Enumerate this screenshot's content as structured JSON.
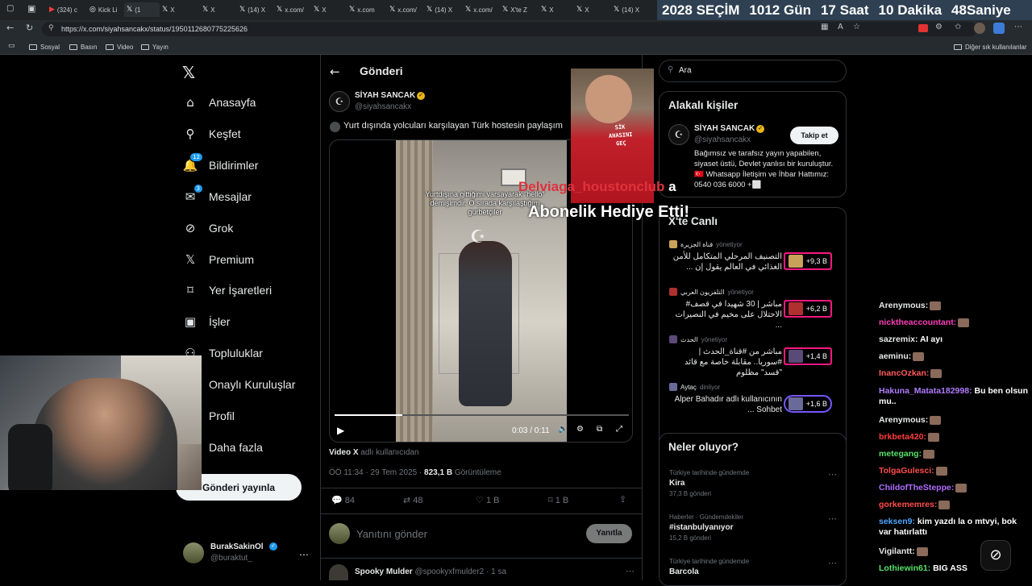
{
  "browser": {
    "tabs": [
      {
        "label": "(324) c",
        "icon": "youtube-icon"
      },
      {
        "label": "Kick Li",
        "icon": "globe-icon"
      },
      {
        "label": "(1",
        "icon": "x-icon"
      },
      {
        "label": "X",
        "icon": "x-icon"
      },
      {
        "label": "X",
        "icon": "x-icon"
      },
      {
        "label": "(14) X",
        "icon": "x-icon"
      },
      {
        "label": "x.com/",
        "icon": "x-icon"
      },
      {
        "label": "X",
        "icon": "x-icon"
      },
      {
        "label": "x.com",
        "icon": "x-icon"
      },
      {
        "label": "x.com/",
        "icon": "x-icon"
      },
      {
        "label": "(14) X",
        "icon": "x-icon"
      },
      {
        "label": "x.com/",
        "icon": "x-icon"
      },
      {
        "label": "X'te Z",
        "icon": "x-icon"
      },
      {
        "label": "X",
        "icon": "x-icon"
      },
      {
        "label": "X",
        "icon": "x-icon"
      },
      {
        "label": "(14) X",
        "icon": "x-icon"
      }
    ],
    "url": "https://x.com/siyahsancakx/status/1950112680775225626",
    "bookmarks": [
      "Sosyal",
      "Basın",
      "Video",
      "Yayın"
    ],
    "other_bookmarks": "Diğer sık kullanılanlar"
  },
  "countdown": {
    "year": "2028",
    "label": "SEÇİM",
    "days": "1012",
    "days_label": "Gün",
    "hours": "17",
    "hours_label": "Saat",
    "minutes": "10",
    "minutes_label": "Dakika",
    "seconds": "48",
    "seconds_label": "Saniye"
  },
  "nav": {
    "items": [
      {
        "label": "Anasayfa",
        "icon": "home-icon"
      },
      {
        "label": "Keşfet",
        "icon": "search-icon"
      },
      {
        "label": "Bildirimler",
        "icon": "bell-icon",
        "badge": "12"
      },
      {
        "label": "Mesajlar",
        "icon": "mail-icon",
        "badge": "3"
      },
      {
        "label": "Grok",
        "icon": "grok-icon"
      },
      {
        "label": "Premium",
        "icon": "x-logo-icon"
      },
      {
        "label": "Yer İşaretleri",
        "icon": "bookmark-icon"
      },
      {
        "label": "İşler",
        "icon": "briefcase-icon"
      },
      {
        "label": "Topluluklar",
        "icon": "people-icon"
      },
      {
        "label": "Onaylı Kuruluşlar",
        "icon": "verified-icon"
      },
      {
        "label": "Profil",
        "icon": "person-icon"
      },
      {
        "label": "Daha fazla",
        "icon": "more-icon"
      }
    ],
    "post_button": "Gönderi yayınla",
    "account": {
      "name": "BurakSakinOl",
      "handle": "@buraktut_"
    }
  },
  "post": {
    "header": "Gönderi",
    "author": "SİYAH SANCAK",
    "handle": "@siyahsancakx",
    "text": "Yurt dışında yolcuları karşılayan Türk hostesin paylaşım",
    "video_caption": "Yurtdışına gittiğimi varsayarak \"hello\" demişimdir. O sırada karşılaştığım gurbetçiler",
    "video_time": "0:03 / 0:11",
    "video_progress": 0.23,
    "attribution_strong": "Video X",
    "attribution_rest": "adlı kullanıcıdan",
    "timestamp": "ÖÖ 11:34 · 29 Tem 2025 ·",
    "views": "823,1 B",
    "views_label": "Görüntüleme",
    "replies": "84",
    "reposts": "48",
    "likes": "1 B",
    "bookmarks": "1 B",
    "reply_placeholder": "Yanıtını gönder",
    "reply_button": "Yanıtla",
    "next_author": "Spooky Mulder",
    "next_handle": "@spookyxfmulder2 · 1 sa"
  },
  "right": {
    "search_placeholder": "Ara",
    "related_title": "Alakalı kişiler",
    "related": {
      "name": "SİYAH SANCAK",
      "handle": "@siyahsancakx",
      "follow": "Takip et",
      "bio": "Bağımsız ve tarafsız yayın yapabilen, siyaset üstü, Devlet yanlısı bir kuruluştur. 🇹🇷 Whatsapp İletişim ve İhbar Hattımız: 0540 036 6000 +⬜"
    },
    "live_title": "X'te Canlı",
    "live": [
      {
        "source": "قناة الجزيرة",
        "role": "yönetiyor",
        "title": "التصنيف المرحلي المتكامل للأمن الغذائي في العالم يقول إن ...",
        "count": "+9,3 B"
      },
      {
        "source": "التلفزيون العربي",
        "role": "yönetiyor",
        "title": "مباشر | 30 شهيدا في قصف# الاحتلال على مخيم في النصيرات ...",
        "count": "+6,2 B"
      },
      {
        "source": "الحدث",
        "role": "yönetiyor",
        "title": "مباشر من #قناة_الحدث | #سوريا.. مقابلة خاصة مع قائد \"قسد\" مظلوم",
        "count": "+1,4 B"
      },
      {
        "source": "Aytaç",
        "role": "dinliyor",
        "title": "Alper Bahadır adlı kullanıcının Sohbet ...",
        "count": "+1,6 B"
      }
    ],
    "trends_title": "Neler oluyor?",
    "trends": [
      {
        "category": "Türkiye tarihinde gündemde",
        "name": "Kira",
        "count": "37,3 B gönderi"
      },
      {
        "category": "Haberler · Gündemdekiler",
        "name": "#istanbulyanıyor",
        "count": "15,2 B gönderi"
      },
      {
        "category": "Türkiye tarihinde gündemde",
        "name": "Barcola",
        "count": ""
      }
    ]
  },
  "overlay": {
    "shirt_text": "SİK\nANASINI\nGEÇ",
    "alert_user": "Delviaga_houstonclub",
    "alert_suffix": "a",
    "alert_message": "Abonelik Hediye Etti!"
  },
  "chat": [
    {
      "user": "Arenymous:",
      "color": "#e7e9ea",
      "msg": ""
    },
    {
      "user": "nicktheaccountant:",
      "color": "#ff3dbb",
      "msg": ""
    },
    {
      "user": "sazremix:",
      "color": "#e7e9ea",
      "msg": "AI ayı"
    },
    {
      "user": "aeminu:",
      "color": "#e7e9ea",
      "msg": ""
    },
    {
      "user": "InancOzkan:",
      "color": "#ff5a5a",
      "msg": ""
    },
    {
      "user": "Hakuna_Matata182998:",
      "color": "#b07cff",
      "msg": "Bu ben olsun mu.."
    },
    {
      "user": "Arenymous:",
      "color": "#e7e9ea",
      "msg": ""
    },
    {
      "user": "brkbeta420:",
      "color": "#ff3d3d",
      "msg": ""
    },
    {
      "user": "metegang:",
      "color": "#58e06a",
      "msg": ""
    },
    {
      "user": "TolgaGulesci:",
      "color": "#ff4d4d",
      "msg": ""
    },
    {
      "user": "ChildofTheSteppe:",
      "color": "#b06cff",
      "msg": ""
    },
    {
      "user": "gorkememres:",
      "color": "#ff4d4d",
      "msg": ""
    },
    {
      "user": "seksen9:",
      "color": "#4ea6ff",
      "msg": "kim yazdı la o mtvyi, bok var hatırlattı"
    },
    {
      "user": "Vigilantt:",
      "color": "#e7e9ea",
      "msg": ""
    },
    {
      "user": "Lothiewin61:",
      "color": "#58e06a",
      "msg": "BIG ASS"
    }
  ]
}
